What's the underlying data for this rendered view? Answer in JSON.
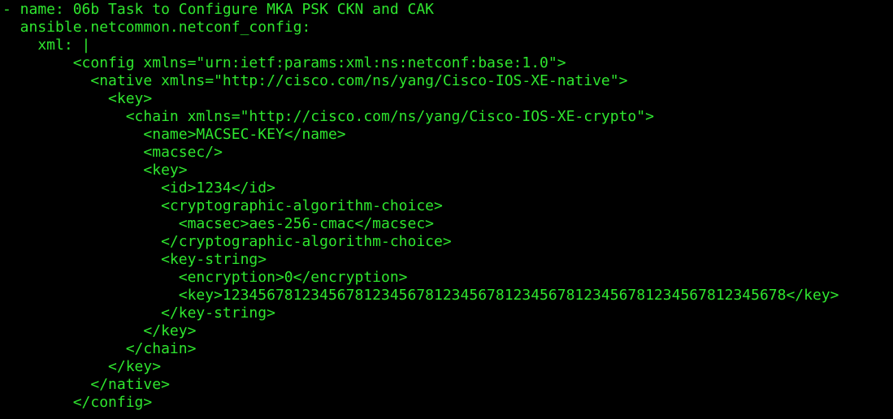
{
  "terminal": {
    "text_color": "#2fe62f",
    "background_color": "#000000",
    "lines": [
      "- name: 06b Task to Configure MKA PSK CKN and CAK",
      "  ansible.netcommon.netconf_config:",
      "    xml: |",
      "        <config xmlns=\"urn:ietf:params:xml:ns:netconf:base:1.0\">",
      "          <native xmlns=\"http://cisco.com/ns/yang/Cisco-IOS-XE-native\">",
      "            <key>",
      "              <chain xmlns=\"http://cisco.com/ns/yang/Cisco-IOS-XE-crypto\">",
      "                <name>MACSEC-KEY</name>",
      "                <macsec/>",
      "                <key>",
      "                  <id>1234</id>",
      "                  <cryptographic-algorithm-choice>",
      "                    <macsec>aes-256-cmac</macsec>",
      "                  </cryptographic-algorithm-choice>",
      "                  <key-string>",
      "                    <encryption>0</encryption>",
      "                    <key>1234567812345678123456781234567812345678123456781234567812345678</key>",
      "                  </key-string>",
      "                </key>",
      "              </chain>",
      "            </key>",
      "          </native>",
      "        </config>"
    ]
  }
}
